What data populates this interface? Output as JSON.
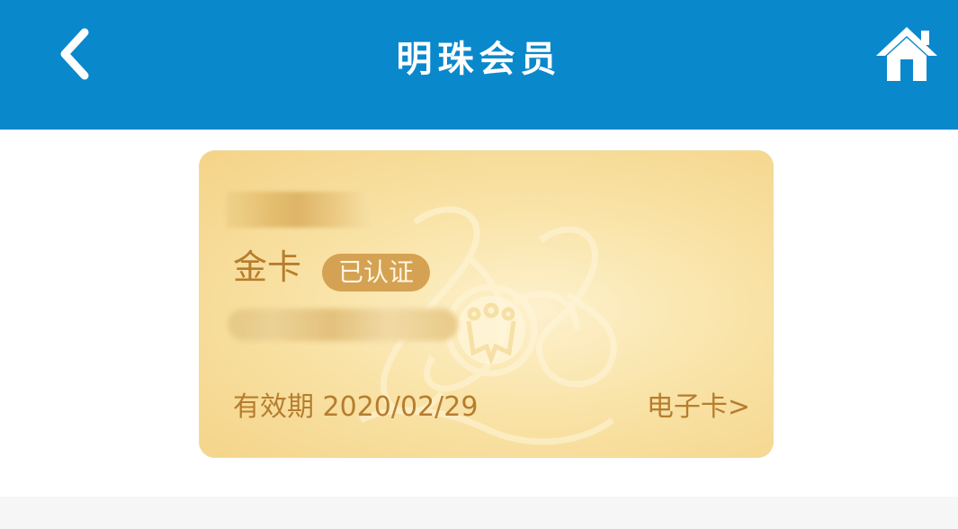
{
  "header": {
    "title": "明珠会员",
    "back_icon": "back-arrow-icon",
    "home_icon": "home-icon",
    "background_color": "#0a88cc"
  },
  "card": {
    "tier": "金卡",
    "verified_badge": "已认证",
    "expiry": "有效期 2020/02/29",
    "ecard_link": "电子卡>",
    "text_color": "#b67d2e",
    "badge_color": "#d4a252"
  }
}
